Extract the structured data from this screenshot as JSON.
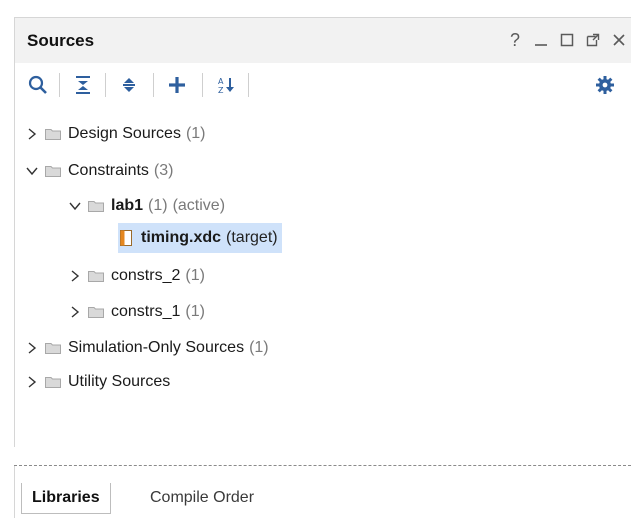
{
  "panel": {
    "title": "Sources",
    "window_controls": [
      {
        "name": "help",
        "glyph": "?"
      },
      {
        "name": "minimize"
      },
      {
        "name": "maximize"
      },
      {
        "name": "float"
      },
      {
        "name": "close"
      }
    ]
  },
  "toolbar": {
    "icons": [
      "search-icon",
      "collapse-all-icon",
      "expand-all-icon",
      "add-icon",
      "sort-az-icon",
      "gear-icon"
    ]
  },
  "tree": {
    "design_sources": {
      "label": "Design Sources",
      "count": "(1)"
    },
    "constraints": {
      "label": "Constraints",
      "count": "(3)"
    },
    "lab1": {
      "label": "lab1",
      "count": "(1)",
      "status": "(active)"
    },
    "timing": {
      "label": "timing.xdc",
      "tag": "(target)"
    },
    "constrs_2": {
      "label": "constrs_2",
      "count": "(1)"
    },
    "constrs_1": {
      "label": "constrs_1",
      "count": "(1)"
    },
    "sim_sources": {
      "label": "Simulation-Only Sources",
      "count": "(1)"
    },
    "utility_sources": {
      "label": "Utility Sources"
    }
  },
  "tabs": [
    {
      "label": "Libraries",
      "active": true
    },
    {
      "label": "Compile Order",
      "active": false
    }
  ],
  "colors": {
    "selection": "#cfe2fa",
    "icon_blue": "#2e5f9e",
    "folder_gray": "#c4c4c4",
    "file_orange": "#e5871f"
  }
}
